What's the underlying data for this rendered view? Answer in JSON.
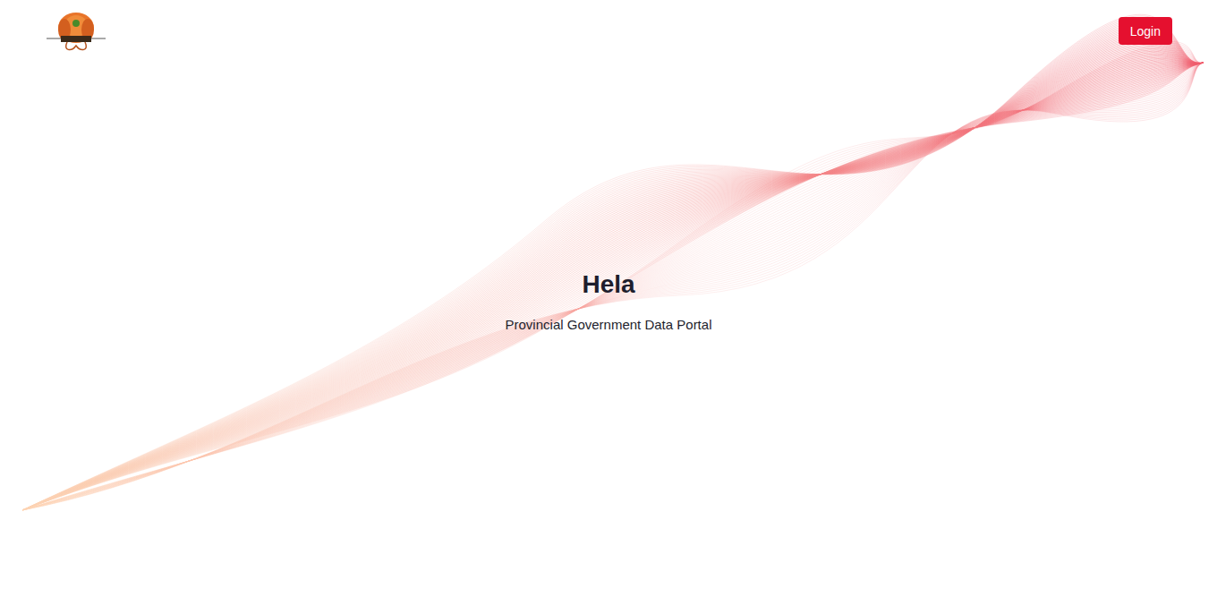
{
  "header": {
    "login_button": "Login"
  },
  "hero": {
    "title": "Hela",
    "subtitle": "Provincial Government Data Portal"
  }
}
